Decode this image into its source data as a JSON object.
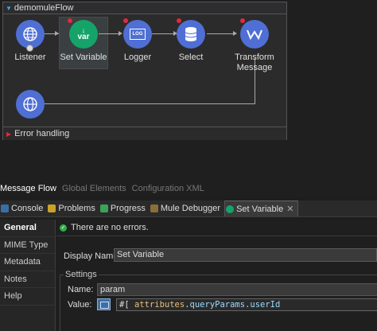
{
  "flow": {
    "name": "demomuleFlow",
    "error_handling": "Error handling",
    "nodes": [
      {
        "label": "Listener",
        "icon": "globe-icon",
        "color": "#4f6fd4"
      },
      {
        "label": "Set Variable",
        "icon": "var-icon",
        "color": "#15a36a"
      },
      {
        "label": "Logger",
        "icon": "log-icon",
        "color": "#4f6fd4"
      },
      {
        "label": "Select",
        "icon": "database-icon",
        "color": "#4f6fd4"
      },
      {
        "label": "Transform Message",
        "icon": "transform-icon",
        "color": "#4f6fd4"
      }
    ],
    "var_icon_text": "var",
    "log_icon_text": "LOG"
  },
  "editor_tabs": {
    "message_flow": "Message Flow",
    "global_elements": "Global Elements",
    "configuration_xml": "Configuration XML"
  },
  "view_tabs": {
    "console": "Console",
    "problems": "Problems",
    "progress": "Progress",
    "mule_debugger": "Mule Debugger",
    "set_variable": "Set Variable"
  },
  "nav": [
    "General",
    "MIME Type",
    "Metadata",
    "Notes",
    "Help"
  ],
  "props": {
    "status": "There are no errors.",
    "display_name_label": "Display Name:",
    "display_name_value": "Set Variable",
    "settings_title": "Settings",
    "name_label": "Name:",
    "name_value": "param",
    "value_label": "Value:",
    "value_prefix": "#[",
    "value_expr": "attributes",
    "value_dot": ".",
    "value_prop": "queryParams.userId"
  },
  "colors": {
    "accent_blue": "#4f6fd4",
    "accent_green": "#15a36a",
    "error_red": "#e0293e"
  }
}
